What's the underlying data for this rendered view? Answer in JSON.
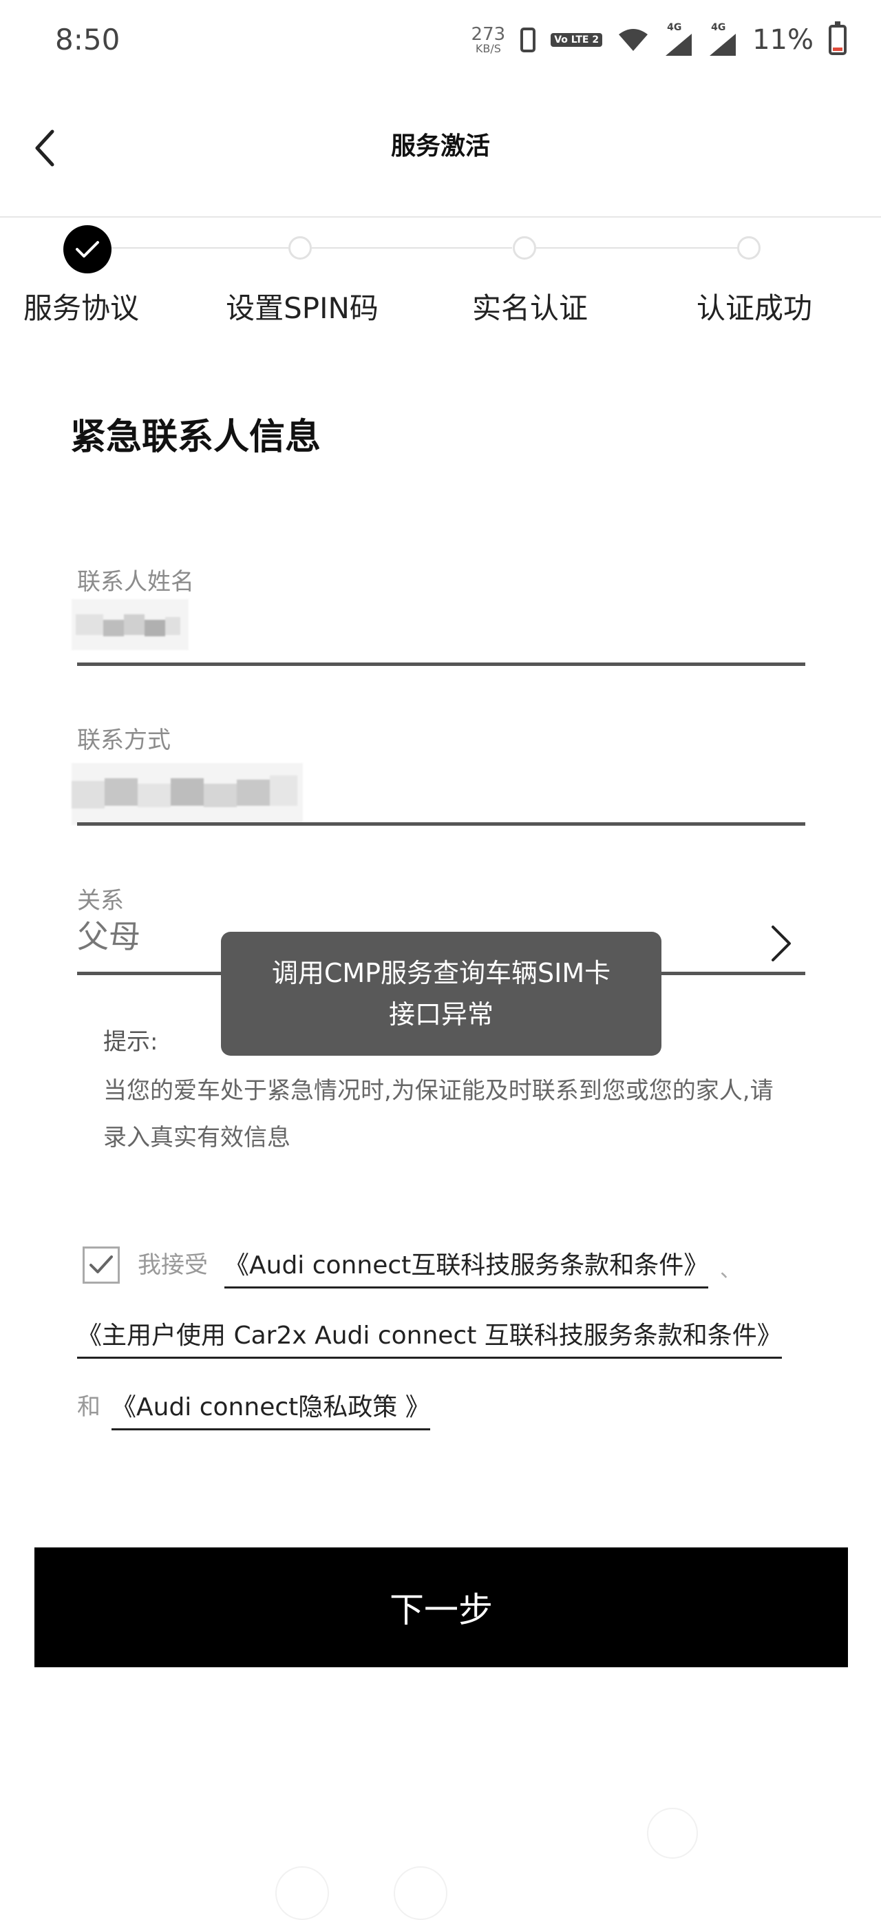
{
  "status_bar": {
    "time": "8:50",
    "net_speed": "273",
    "net_unit": "KB/S",
    "volte": "Vo LTE 2",
    "signal_label_1": "4G",
    "signal_label_2": "4G",
    "battery": "11%",
    "battery_level": 0.11
  },
  "header": {
    "title": "服务激活"
  },
  "stepper": {
    "steps": [
      {
        "label": "服务协议",
        "status": "done"
      },
      {
        "label": "设置SPIN码",
        "status": "pending"
      },
      {
        "label": "实名认证",
        "status": "pending"
      },
      {
        "label": "认证成功",
        "status": "pending"
      }
    ]
  },
  "form": {
    "section_title": "紧急联系人信息",
    "name_label": "联系人姓名",
    "phone_label": "联系方式",
    "relation_label": "关系",
    "relation_value": "父母"
  },
  "tip": {
    "label": "提示:",
    "text": "当您的爱车处于紧急情况时,为保证能及时联系到您或您的家人,请录入真实有效信息"
  },
  "toast": {
    "line1": "调用CMP服务查询车辆SIM卡",
    "line2": "接口异常"
  },
  "agreement": {
    "checked": true,
    "prefix": "我接受",
    "link1": "《Audi connect互联科技服务条款和条件》",
    "sep1": "、",
    "link2": "《主用户使用 Car2x Audi connect 互联科技服务条款和条件》",
    "and": "和",
    "link3": "《Audi connect隐私政策 》"
  },
  "next_button": {
    "label": "下一步"
  }
}
